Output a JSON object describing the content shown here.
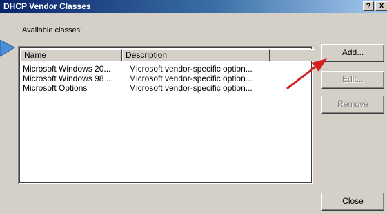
{
  "window": {
    "title": "DHCP Vendor Classes",
    "help_label": "?",
    "close_label": "X"
  },
  "available_label": "Available classes:",
  "list": {
    "columns": [
      "Name",
      "Description",
      ""
    ],
    "rows": [
      {
        "name": "Microsoft Windows 20...",
        "description": "Microsoft vendor-specific option..."
      },
      {
        "name": "Microsoft Windows 98 ...",
        "description": "Microsoft vendor-specific option..."
      },
      {
        "name": "Microsoft Options",
        "description": "Microsoft vendor-specific option..."
      }
    ]
  },
  "buttons": {
    "add": "Add...",
    "edit": "Edit...",
    "remove": "Remove",
    "close": "Close"
  },
  "colors": {
    "title_start": "#0a246a",
    "title_end": "#a6caf0",
    "annotation_arrow": "#d42020",
    "pointer_arrow": "#4a90d9"
  }
}
